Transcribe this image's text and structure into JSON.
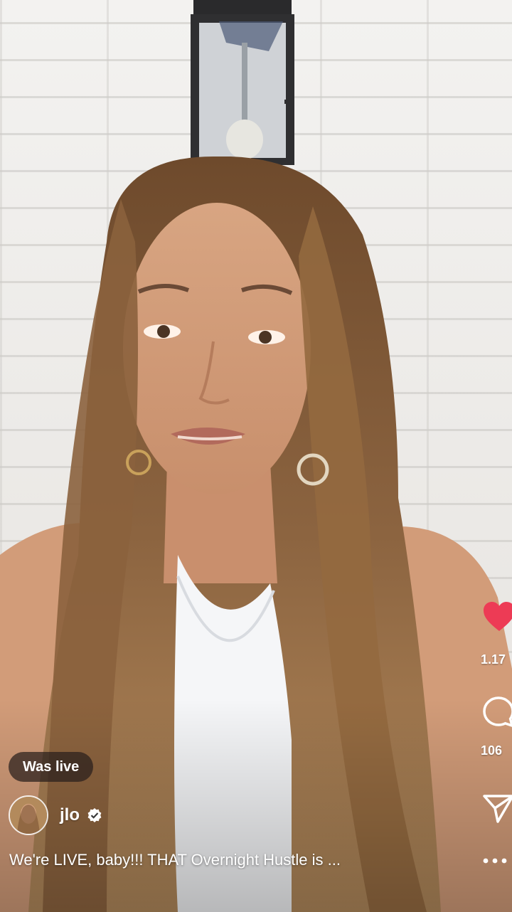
{
  "live_badge": {
    "label": "Was live"
  },
  "author": {
    "username": "jlo",
    "verified": true
  },
  "caption": {
    "text": "We're LIVE, baby!!! THAT Overnight Hustle is ..."
  },
  "actions": {
    "like": {
      "icon": "heart-icon",
      "count": "1.17",
      "color": "#ed3b55"
    },
    "comment": {
      "icon": "comment-icon",
      "count": "106"
    },
    "share": {
      "icon": "send-icon"
    },
    "more": {
      "icon": "more-icon"
    }
  }
}
